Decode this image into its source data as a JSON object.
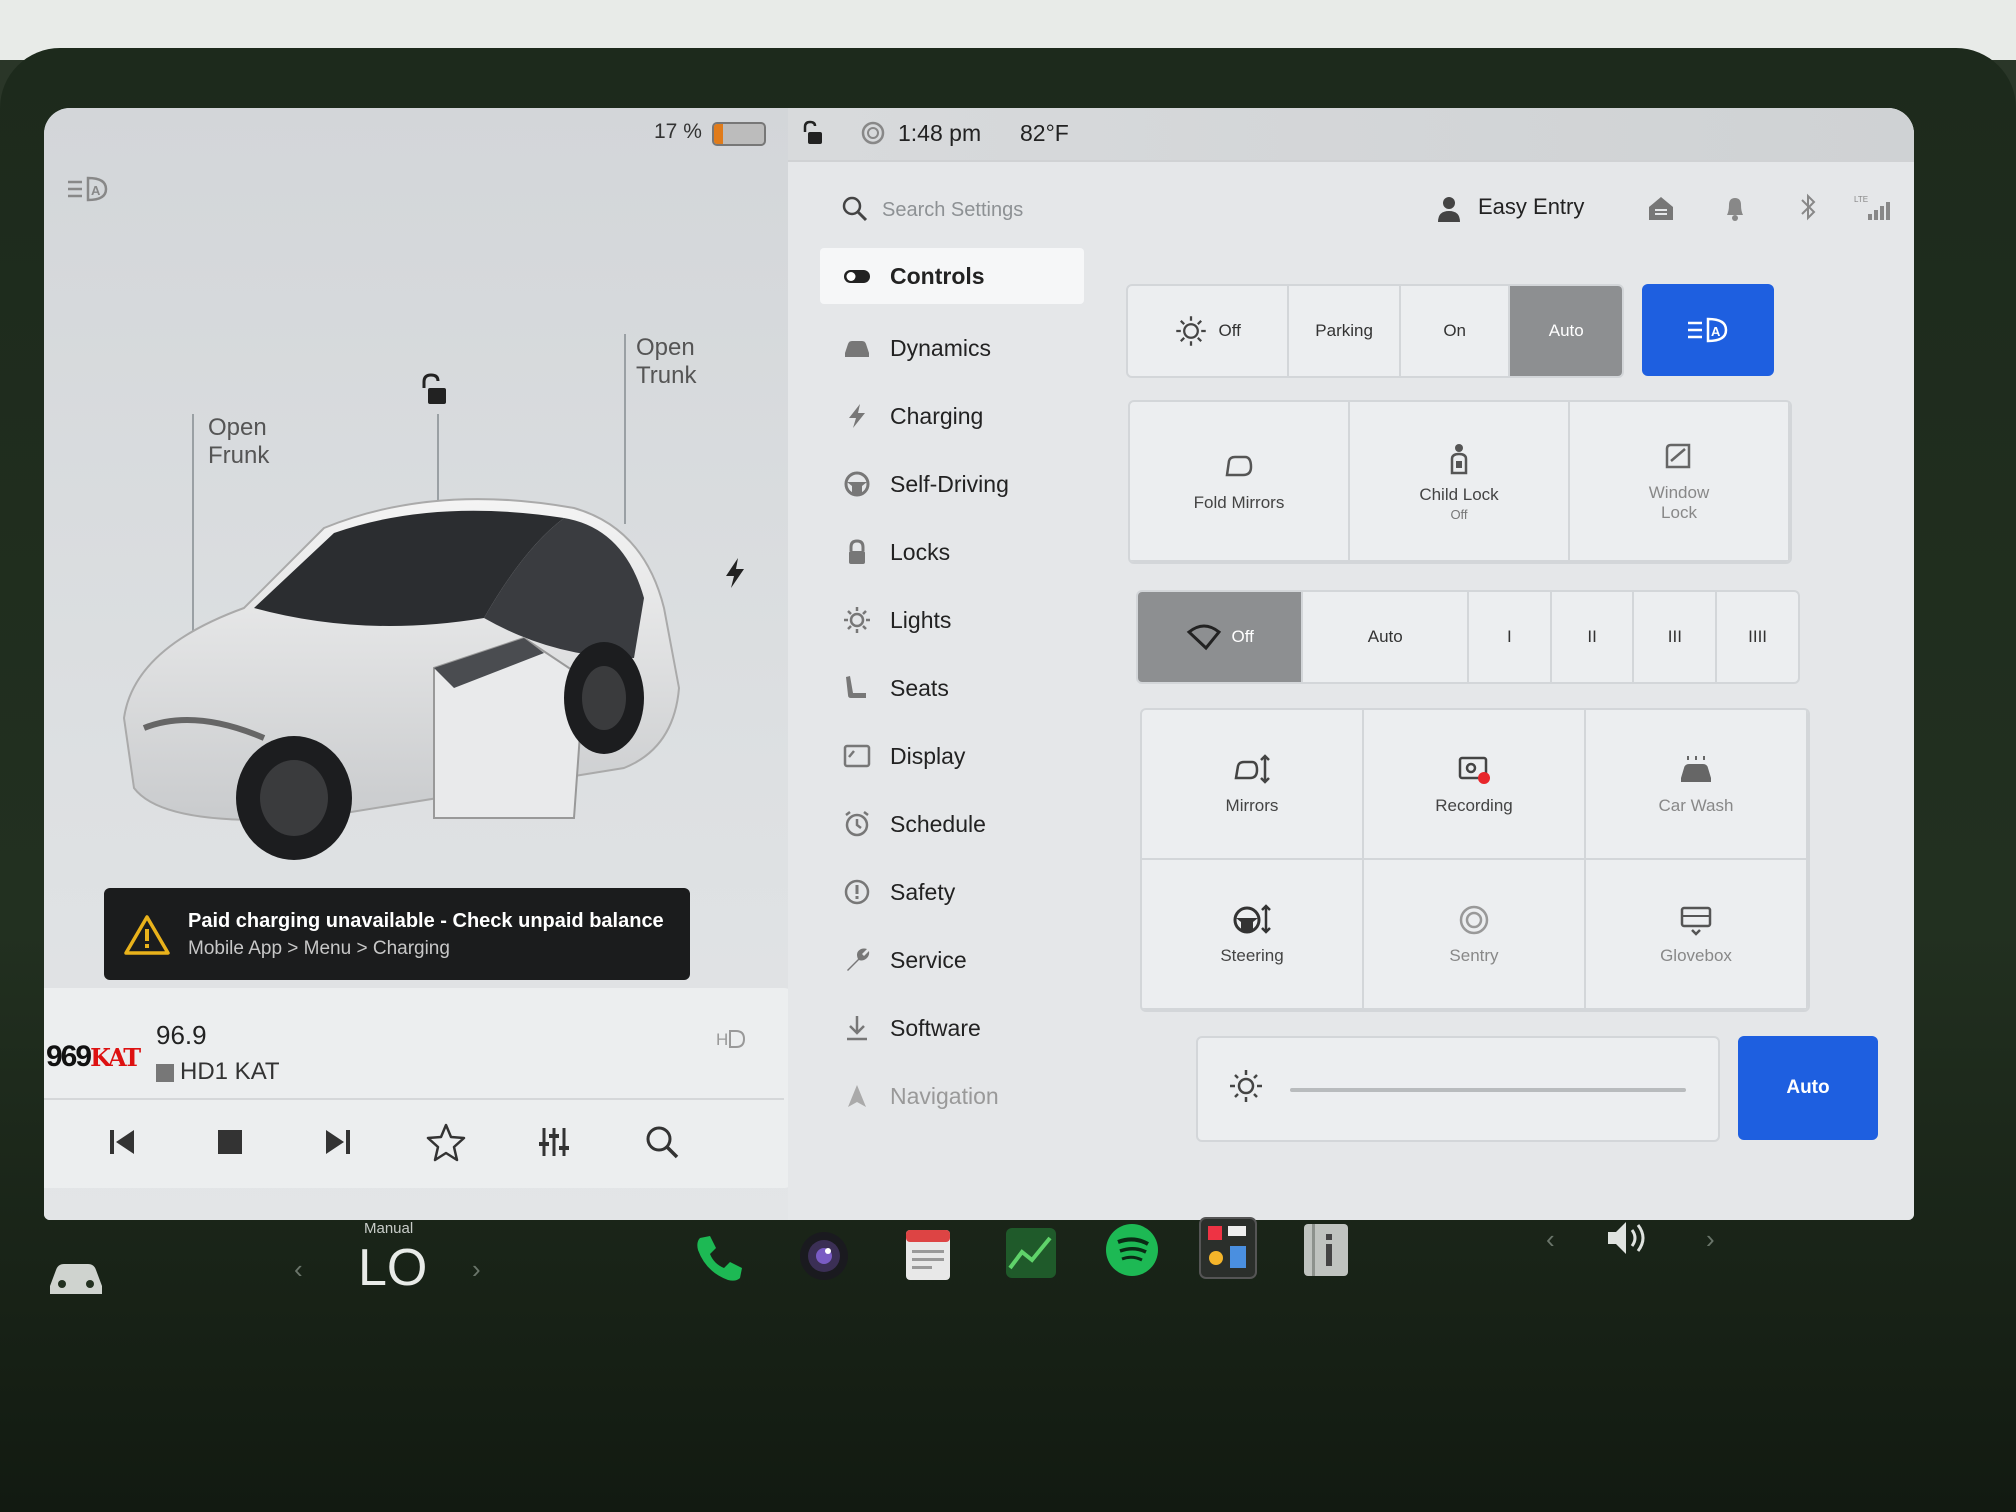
{
  "status": {
    "battery_percent": "17 %",
    "battery_level": 0.17,
    "time": "1:48 pm",
    "temperature": "82°F"
  },
  "car_view": {
    "open_frunk": [
      "Open",
      "Frunk"
    ],
    "open_trunk": [
      "Open",
      "Trunk"
    ]
  },
  "alert": {
    "title": "Paid charging unavailable - Check unpaid balance",
    "subtitle": "Mobile App > Menu > Charging"
  },
  "media": {
    "station_logo_number": "969",
    "station_logo_text": "KAT",
    "frequency": "96.9",
    "station_name": "HD1 KAT"
  },
  "search": {
    "placeholder": "Search Settings"
  },
  "profile": {
    "name": "Easy Entry"
  },
  "nav": {
    "items": [
      {
        "label": "Controls",
        "icon": "toggle-icon"
      },
      {
        "label": "Dynamics",
        "icon": "car-icon"
      },
      {
        "label": "Charging",
        "icon": "bolt-icon"
      },
      {
        "label": "Self-Driving",
        "icon": "steering-wheel-icon"
      },
      {
        "label": "Locks",
        "icon": "lock-icon"
      },
      {
        "label": "Lights",
        "icon": "sun-icon"
      },
      {
        "label": "Seats",
        "icon": "seat-icon"
      },
      {
        "label": "Display",
        "icon": "display-icon"
      },
      {
        "label": "Schedule",
        "icon": "alarm-icon"
      },
      {
        "label": "Safety",
        "icon": "alert-circle-icon"
      },
      {
        "label": "Service",
        "icon": "wrench-icon"
      },
      {
        "label": "Software",
        "icon": "download-icon"
      },
      {
        "label": "Navigation",
        "icon": "navigation-icon"
      }
    ]
  },
  "lights": {
    "options": [
      "Off",
      "Parking",
      "On",
      "Auto"
    ],
    "selected": "Auto"
  },
  "tiles_top": [
    {
      "label": "Fold Mirrors",
      "sub": ""
    },
    {
      "label": "Child Lock",
      "sub": "Off"
    },
    {
      "label": "Window Lock",
      "sub": ""
    }
  ],
  "wipers": {
    "options": [
      "Off",
      "Auto",
      "I",
      "II",
      "III",
      "IIII"
    ],
    "selected": "Off"
  },
  "tiles_bottom": [
    {
      "label": "Mirrors"
    },
    {
      "label": "Recording"
    },
    {
      "label": "Car Wash"
    },
    {
      "label": "Steering"
    },
    {
      "label": "Sentry"
    },
    {
      "label": "Glovebox"
    }
  ],
  "brightness": {
    "auto_label": "Auto"
  },
  "climate": {
    "mode": "Manual",
    "value": "LO"
  },
  "colors": {
    "accent_blue": "#1e5fe0",
    "battery_orange": "#e07b1a",
    "phone_green": "#1db954"
  }
}
